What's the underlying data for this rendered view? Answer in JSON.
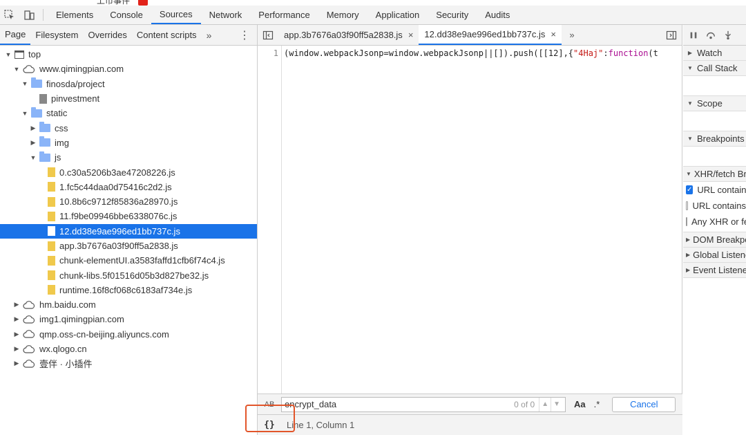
{
  "page_fragment": {
    "text": "上市事件"
  },
  "toolbar": {
    "tabs": [
      "Elements",
      "Console",
      "Sources",
      "Network",
      "Performance",
      "Memory",
      "Application",
      "Security",
      "Audits"
    ],
    "active_tab": "Sources"
  },
  "navigator": {
    "tabs": [
      "Page",
      "Filesystem",
      "Overrides",
      "Content scripts"
    ],
    "more": "»",
    "kebab": "⋮",
    "tree": [
      {
        "label": "top",
        "depth": 0,
        "type": "frame",
        "expanded": true
      },
      {
        "label": "www.qimingpian.com",
        "depth": 1,
        "type": "cloud",
        "expanded": true
      },
      {
        "label": "finosda/project",
        "depth": 2,
        "type": "folder",
        "expanded": true
      },
      {
        "label": "pinvestment",
        "depth": 3,
        "type": "file-gray"
      },
      {
        "label": "static",
        "depth": 2,
        "type": "folder",
        "expanded": true
      },
      {
        "label": "css",
        "depth": 3,
        "type": "folder",
        "expanded": false
      },
      {
        "label": "img",
        "depth": 3,
        "type": "folder",
        "expanded": false
      },
      {
        "label": "js",
        "depth": 3,
        "type": "folder",
        "expanded": true
      },
      {
        "label": "0.c30a5206b3ae47208226.js",
        "depth": 4,
        "type": "file"
      },
      {
        "label": "1.fc5c44daa0d75416c2d2.js",
        "depth": 4,
        "type": "file"
      },
      {
        "label": "10.8b6c9712f85836a28970.js",
        "depth": 4,
        "type": "file"
      },
      {
        "label": "11.f9be09946bbe6338076c.js",
        "depth": 4,
        "type": "file"
      },
      {
        "label": "12.dd38e9ae996ed1bb737c.js",
        "depth": 4,
        "type": "file",
        "selected": true
      },
      {
        "label": "app.3b7676a03f90ff5a2838.js",
        "depth": 4,
        "type": "file"
      },
      {
        "label": "chunk-elementUI.a3583faffd1cfb6f74c4.js",
        "depth": 4,
        "type": "file"
      },
      {
        "label": "chunk-libs.5f01516d05b3d827be32.js",
        "depth": 4,
        "type": "file"
      },
      {
        "label": "runtime.16f8cf068c6183af734e.js",
        "depth": 4,
        "type": "file"
      },
      {
        "label": "hm.baidu.com",
        "depth": 1,
        "type": "cloud",
        "expanded": false
      },
      {
        "label": "img1.qimingpian.com",
        "depth": 1,
        "type": "cloud",
        "expanded": false
      },
      {
        "label": "qmp.oss-cn-beijing.aliyuncs.com",
        "depth": 1,
        "type": "cloud",
        "expanded": false
      },
      {
        "label": "wx.qlogo.cn",
        "depth": 1,
        "type": "cloud",
        "expanded": false
      },
      {
        "label": "壹伴 · 小插件",
        "depth": 1,
        "type": "cloud",
        "expanded": false
      }
    ]
  },
  "editor": {
    "tabs": [
      {
        "label": "app.3b7676a03f90ff5a2838.js",
        "close": "×",
        "active": false
      },
      {
        "label": "12.dd38e9ae996ed1bb737c.js",
        "close": "×",
        "active": true
      }
    ],
    "more": "»",
    "line_number": "1",
    "code_parts": [
      "(window.webpackJsonp=window.webpackJsonp||[]).push([[12],{",
      "\"4Haj\"",
      ":",
      "function",
      "(t"
    ],
    "search": {
      "toggle": "AB",
      "value": "encrypt_data",
      "count": "0 of 0",
      "prev": "▲",
      "next": "▼",
      "match_case": "Aa",
      "regex": ".*",
      "cancel": "Cancel"
    },
    "status": {
      "pretty_print": "{}",
      "position": "Line 1, Column 1"
    }
  },
  "debugger": {
    "panes": [
      "Watch",
      "Call Stack",
      "Scope",
      "Breakpoints",
      "XHR/fetch Breakpoints",
      "DOM Breakpoints",
      "Global Listeners",
      "Event Listeners"
    ],
    "xhr_items": [
      {
        "label": "URL contains",
        "checked": true
      },
      {
        "label": "URL contains",
        "checked": false
      },
      {
        "label": "Any XHR or fetch",
        "checked": false
      }
    ]
  },
  "colors": {
    "accent": "#1a73e8",
    "highlight_box": "#e2552a"
  }
}
